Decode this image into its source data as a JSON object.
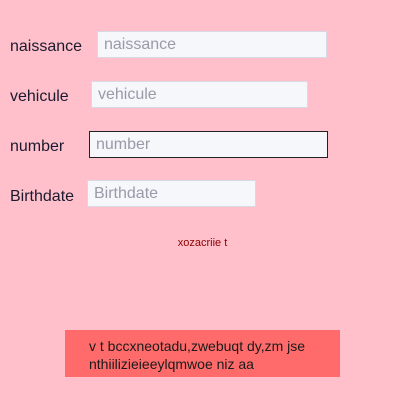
{
  "form": {
    "naissance": {
      "label": "naissance",
      "placeholder": "naissance",
      "value": ""
    },
    "vehicule": {
      "label": "vehicule",
      "placeholder": "vehicule",
      "value": ""
    },
    "number": {
      "label": "number",
      "placeholder": "number",
      "value": ""
    },
    "birthdate": {
      "label": "Birthdate",
      "placeholder": "Birthdate",
      "value": ""
    }
  },
  "link_text": "xozacriie  t",
  "banner": {
    "line1": "v  t bccxneotadu,zwebuqt dy,zm jse",
    "line2": "nthiilizieieeylqmwoe niz aa"
  },
  "colors": {
    "background": "#ffc0cb",
    "input_bg": "#f5f7fb",
    "link": "#8b0000",
    "banner_bg": "#ff6b6b"
  }
}
